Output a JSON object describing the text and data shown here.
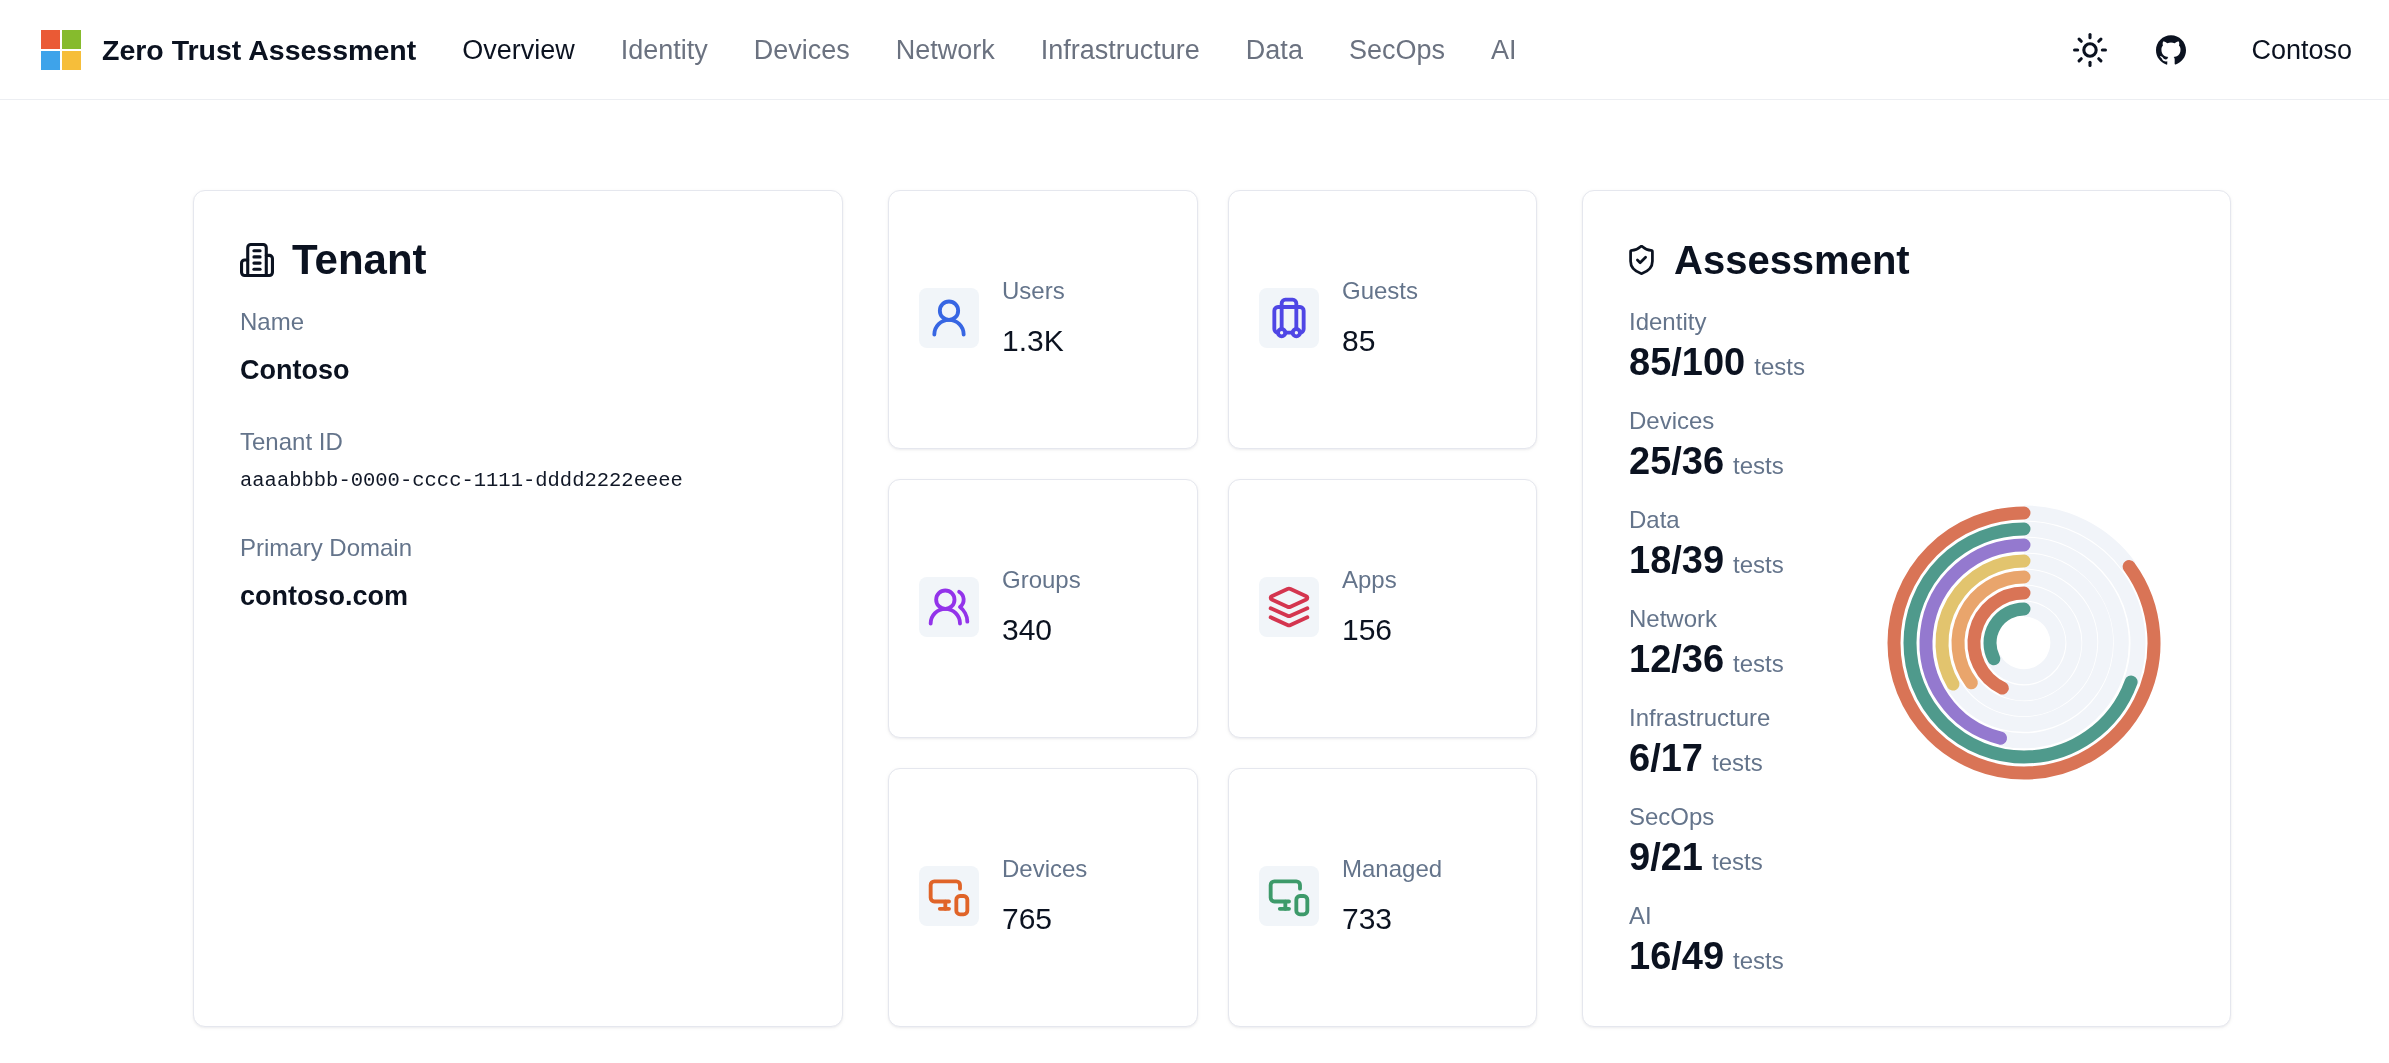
{
  "header": {
    "title": "Zero Trust Assessment",
    "nav": [
      {
        "label": "Overview",
        "selected": true
      },
      {
        "label": "Identity",
        "selected": false
      },
      {
        "label": "Devices",
        "selected": false
      },
      {
        "label": "Network",
        "selected": false
      },
      {
        "label": "Infrastructure",
        "selected": false
      },
      {
        "label": "Data",
        "selected": false
      },
      {
        "label": "SecOps",
        "selected": false
      },
      {
        "label": "AI",
        "selected": false
      }
    ],
    "tenant_name": "Contoso"
  },
  "tenant": {
    "title": "Tenant",
    "fields": [
      {
        "label": "Name",
        "value": "Contoso",
        "kind": "text"
      },
      {
        "label": "Tenant ID",
        "value": "aaaabbbb-0000-cccc-1111-dddd2222eeee",
        "kind": "code"
      },
      {
        "label": "Primary Domain",
        "value": "contoso.com",
        "kind": "text"
      }
    ]
  },
  "stats": [
    {
      "label": "Users",
      "value": "1.3K",
      "color": "#3766e3"
    },
    {
      "label": "Guests",
      "value": "85",
      "color": "#4f46e5"
    },
    {
      "label": "Groups",
      "value": "340",
      "color": "#9333ea"
    },
    {
      "label": "Apps",
      "value": "156",
      "color": "#d4354f"
    },
    {
      "label": "Devices",
      "value": "765",
      "color": "#e06428"
    },
    {
      "label": "Managed",
      "value": "733",
      "color": "#3d9a6a"
    }
  ],
  "assessment": {
    "title": "Assessment",
    "items": [
      {
        "label": "Identity",
        "score": "85/100",
        "unit": "tests"
      },
      {
        "label": "Devices",
        "score": "25/36",
        "unit": "tests"
      },
      {
        "label": "Data",
        "score": "18/39",
        "unit": "tests"
      },
      {
        "label": "Network",
        "score": "12/36",
        "unit": "tests"
      },
      {
        "label": "Infrastructure",
        "score": "6/17",
        "unit": "tests"
      },
      {
        "label": "SecOps",
        "score": "9/21",
        "unit": "tests"
      },
      {
        "label": "AI",
        "score": "16/49",
        "unit": "tests"
      }
    ]
  }
}
